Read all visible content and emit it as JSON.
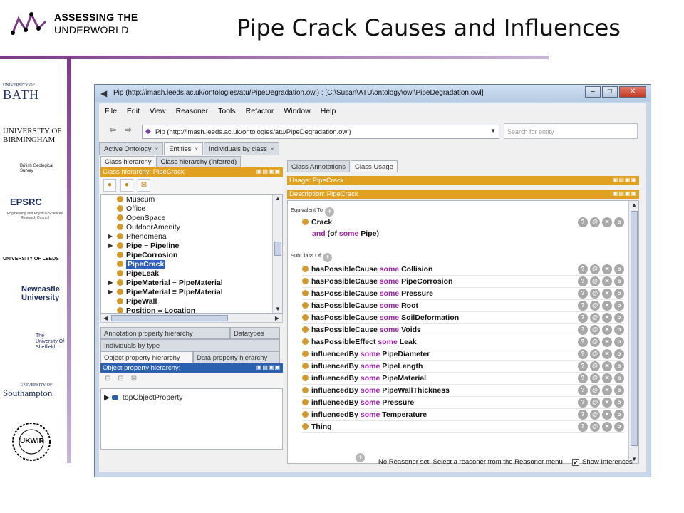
{
  "slide": {
    "logo_line1": "ASSESSING THE",
    "logo_line2": "UNDERWORLD",
    "title": "Pipe Crack Causes and Influences"
  },
  "sponsors": {
    "bath": "BATH",
    "bath_small": "UNIVERSITY OF",
    "birmingham": "UNIVERSITY OF BIRMINGHAM",
    "bgs": "British Geological Survey",
    "epsrc": "EPSRC",
    "epsrc_sub": "Engineering and Physical Sciences Research Council",
    "leeds": "UNIVERSITY OF LEEDS",
    "newcastle": "Newcastle University",
    "sheffield": "The University Of Sheffield.",
    "southampton_small": "UNIVERSITY OF",
    "southampton": "Southampton",
    "ukwir": "UKWIR"
  },
  "window": {
    "title": "Pip (http://imash.leeds.ac.uk/ontologies/atu/PipeDegradation.owl)  : [C:\\Susan\\ATU\\ontology\\owl\\PipeDegradation.owl]",
    "menu": [
      "File",
      "Edit",
      "View",
      "Reasoner",
      "Tools",
      "Refactor",
      "Window",
      "Help"
    ],
    "address": "Pip (http://imash.leeds.ac.uk/ontologies/atu/PipeDegradation.owl)",
    "search_placeholder": "Search for entity",
    "tabs": [
      "Active Ontology",
      "Entities",
      "Individuals by class"
    ]
  },
  "left": {
    "subtabs": [
      "Class hierarchy",
      "Class hierarchy (inferred)"
    ],
    "header": "Class hierarchy: PipeCrack",
    "tree": [
      {
        "label": "Museum",
        "bold": false
      },
      {
        "label": "Office",
        "bold": false
      },
      {
        "label": "OpenSpace",
        "bold": false
      },
      {
        "label": "OutdoorAmenity",
        "bold": false
      },
      {
        "label": "Phenomena",
        "bold": false,
        "expand": true
      },
      {
        "label": "Pipe ≡ Pipeline",
        "bold": true,
        "expand": true
      },
      {
        "label": "PipeCorrosion",
        "bold": true
      },
      {
        "label": "PipeCrack",
        "bold": true,
        "selected": true
      },
      {
        "label": "PipeLeak",
        "bold": true
      },
      {
        "label": "PipeMaterial ≡ PipeMaterial",
        "bold": true,
        "expand": true
      },
      {
        "label": "PipeMaterial ≡ PipeMaterial",
        "bold": true,
        "expand": true
      },
      {
        "label": "PipeWall",
        "bold": true
      },
      {
        "label": "Position ≡ Location",
        "bold": true
      }
    ],
    "lower_tabs_row1": [
      "Annotation property hierarchy",
      "Datatypes"
    ],
    "lower_tabs_row2": [
      "Individuals by type"
    ],
    "lower_tabs_row3": [
      "Object property hierarchy",
      "Data property hierarchy"
    ],
    "obj_header": "Object property hierarchy:",
    "obj_root": "topObjectProperty"
  },
  "right": {
    "tabs": [
      "Class Annotations",
      "Class Usage"
    ],
    "usage_header": "Usage: PipeCrack",
    "desc_header": "Description: PipeCrack",
    "equivalent_label": "Equivalent To",
    "equivalent": {
      "name": "Crack",
      "and_kw": "and",
      "rest1": "(of ",
      "some_kw": "some",
      "rest2": " Pipe)"
    },
    "subclass_label": "SubClass Of",
    "subclasses": [
      {
        "prop": "hasPossibleCause",
        "kw": "some",
        "target": "Collision"
      },
      {
        "prop": "hasPossibleCause",
        "kw": "some",
        "target": "PipeCorrosion"
      },
      {
        "prop": "hasPossibleCause",
        "kw": "some",
        "target": "Pressure"
      },
      {
        "prop": "hasPossibleCause",
        "kw": "some",
        "target": "Root"
      },
      {
        "prop": "hasPossibleCause",
        "kw": "some",
        "target": "SoilDeformation"
      },
      {
        "prop": "hasPossibleCause",
        "kw": "some",
        "target": "Voids"
      },
      {
        "prop": "hasPossibleEffect",
        "kw": "some",
        "target": "Leak"
      },
      {
        "prop": "influencedBy",
        "kw": "some",
        "target": "PipeDiameter"
      },
      {
        "prop": "influencedBy",
        "kw": "some",
        "target": "PipeLength"
      },
      {
        "prop": "influencedBy",
        "kw": "some",
        "target": "PipeMaterial"
      },
      {
        "prop": "influencedBy",
        "kw": "some",
        "target": "PipeWallThickness"
      },
      {
        "prop": "influencedBy",
        "kw": "some",
        "target": "Pressure"
      },
      {
        "prop": "influencedBy",
        "kw": "some",
        "target": "Temperature"
      },
      {
        "prop": "Thing",
        "kw": "",
        "target": ""
      }
    ],
    "status_msg": "No Reasoner set. Select a reasoner from the Reasoner menu",
    "show_inferences": "Show Inferences"
  },
  "colors": {
    "accent_purple": "#7a3a86",
    "header_orange": "#e0a020",
    "keyword_purple": "#a020b0",
    "selection_blue": "#2e5fc0"
  }
}
